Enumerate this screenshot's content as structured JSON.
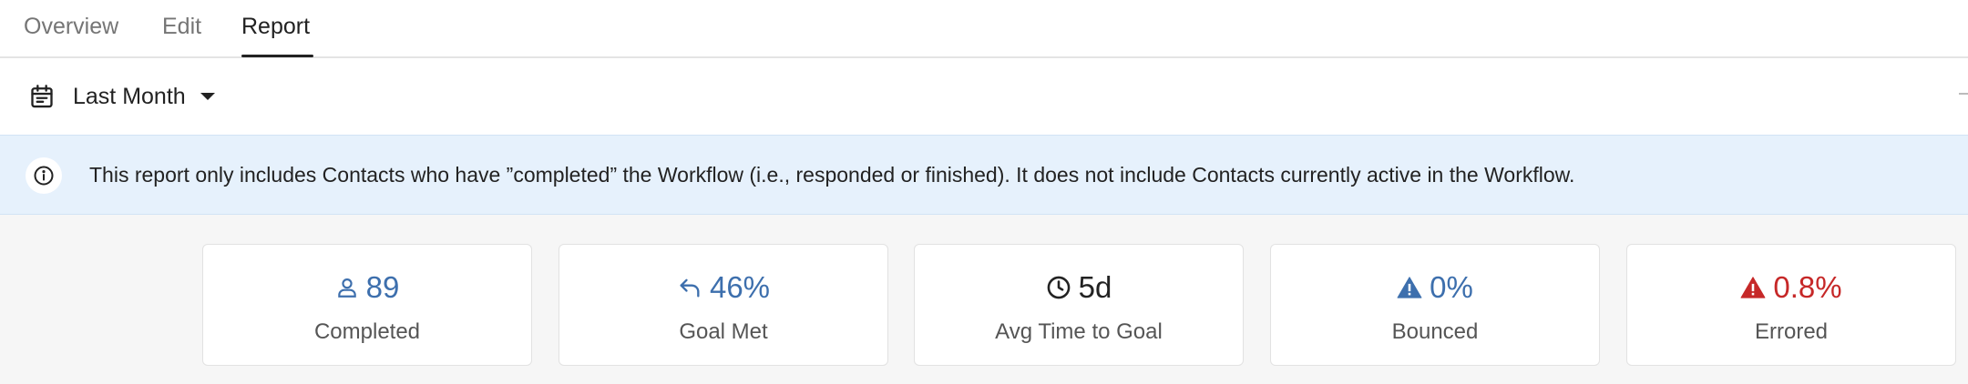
{
  "tabs": [
    {
      "label": "Overview"
    },
    {
      "label": "Edit"
    },
    {
      "label": "Report",
      "active": true
    }
  ],
  "toolbar": {
    "date_range": "Last Month",
    "date_icon": "calendar-icon"
  },
  "banner": {
    "icon": "info-icon",
    "text": "This report only includes Contacts who have ”completed” the Workflow (i.e., responded or finished). It does not include Contacts currently active in the Workflow."
  },
  "stats": [
    {
      "value": "89",
      "label": "Completed",
      "icon": "person-icon",
      "color": "#3d6fad"
    },
    {
      "value": "46%",
      "label": "Goal Met",
      "icon": "reply-arrow-icon",
      "color": "#3d6fad"
    },
    {
      "value": "5d",
      "label": "Avg Time to Goal",
      "icon": "clock-icon",
      "color": "#222222"
    },
    {
      "value": "0%",
      "label": "Bounced",
      "icon": "warning-icon",
      "color": "#3d6fad"
    },
    {
      "value": "0.8%",
      "label": "Errored",
      "icon": "warning-icon",
      "color": "#c62828"
    }
  ]
}
